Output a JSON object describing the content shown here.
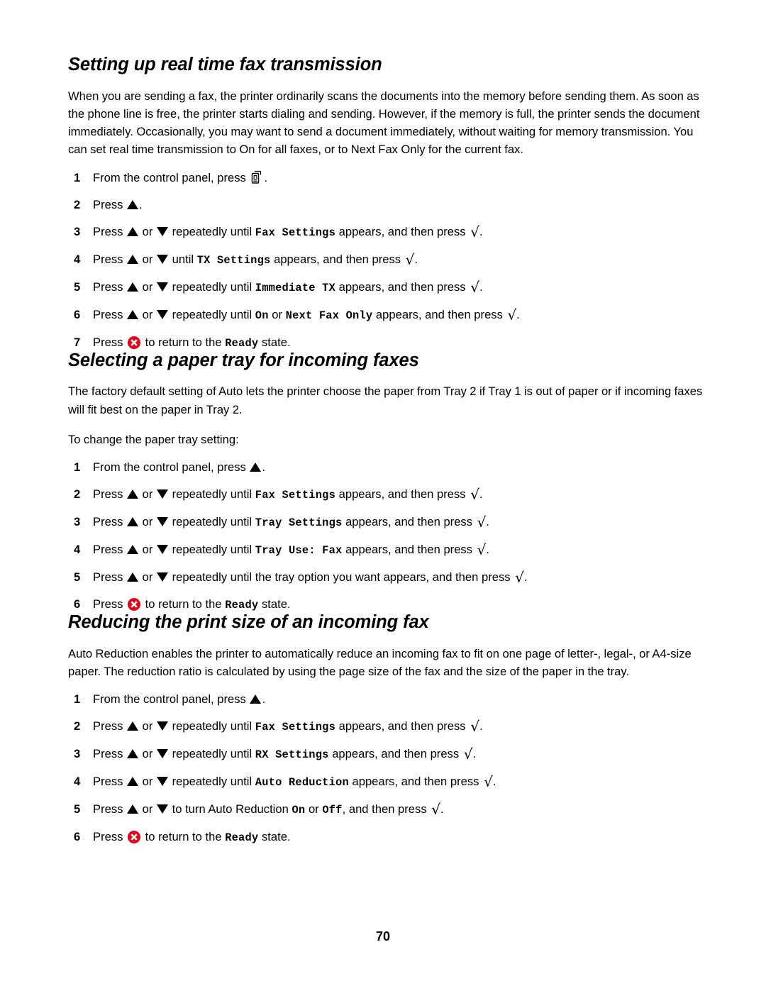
{
  "page": {
    "number": "70",
    "accent_red": "#e10019",
    "text_color": "#000000",
    "background": "#ffffff"
  },
  "sections": [
    {
      "heading": "Setting up real time fax transmission",
      "paragraphs": [
        "When you are sending a fax, the printer ordinarily scans the documents into the memory before sending them. As soon as the phone line is free, the printer starts dialing and sending. However, if the memory is full, the printer sends the document immediately. Occasionally, you may want to send a document immediately, without waiting for memory transmission. You can set real time transmission to On for all faxes, or to Next Fax Only for the current fax."
      ],
      "steps": [
        {
          "num": "1",
          "pre": "From the control panel, press ",
          "icon": "fax-machine-icon",
          "post": "."
        },
        {
          "num": "2",
          "pre": "Press ",
          "icon": "triangle-up-icon",
          "post": "."
        },
        {
          "num": "3",
          "pre": "Press ",
          "icon": "triangle-up-icon",
          "mid1": " or ",
          "icon2": "triangle-down-icon",
          "mid2": " repeatedly until ",
          "mono": "Fax Settings",
          "mid3": " appears, and then press ",
          "icon3": "check-icon",
          "post": "."
        },
        {
          "num": "4",
          "pre": "Press ",
          "icon": "triangle-up-icon",
          "mid1": " or ",
          "icon2": "triangle-down-icon",
          "mid2": " until ",
          "mono": "TX Settings",
          "mid3": " appears, and then press ",
          "icon3": "check-icon",
          "post": "."
        },
        {
          "num": "5",
          "pre": "Press ",
          "icon": "triangle-up-icon",
          "mid1": " or ",
          "icon2": "triangle-down-icon",
          "mid2": " repeatedly until ",
          "mono": "Immediate TX",
          "mid3": " appears, and then press ",
          "icon3": "check-icon",
          "post": "."
        },
        {
          "num": "6",
          "pre": "Press ",
          "icon": "triangle-up-icon",
          "mid1": " or ",
          "icon2": "triangle-down-icon",
          "mid2": " repeatedly until ",
          "mono": "On",
          "mid2b": " or ",
          "mono_b": "Next Fax Only",
          "mid3": " appears, and then press ",
          "icon3": "check-icon",
          "post": "."
        },
        {
          "num": "7",
          "pre": "Press ",
          "icon": "cancel-x-icon",
          "mid2": " to return to the ",
          "mono": "Ready",
          "mid3": " state.",
          "post": ""
        }
      ]
    },
    {
      "heading": "Selecting a paper tray for incoming faxes",
      "paragraphs": [
        "The factory default setting of Auto lets the printer choose the paper from Tray 2 if Tray 1 is out of paper or if incoming faxes will fit best on the paper in Tray 2.",
        "To change the paper tray setting:"
      ],
      "steps": [
        {
          "num": "1",
          "pre": "From the control panel, press ",
          "icon": "triangle-up-icon",
          "post": "."
        },
        {
          "num": "2",
          "pre": "Press ",
          "icon": "triangle-up-icon",
          "mid1": " or ",
          "icon2": "triangle-down-icon",
          "mid2": " repeatedly until ",
          "mono": "Fax Settings",
          "mid3": " appears, and then press ",
          "icon3": "check-icon",
          "post": "."
        },
        {
          "num": "3",
          "pre": "Press ",
          "icon": "triangle-up-icon",
          "mid1": " or ",
          "icon2": "triangle-down-icon",
          "mid2": " repeatedly until ",
          "mono": "Tray Settings",
          "mid3": " appears, and then press ",
          "icon3": "check-icon",
          "post": "."
        },
        {
          "num": "4",
          "pre": "Press ",
          "icon": "triangle-up-icon",
          "mid1": " or ",
          "icon2": "triangle-down-icon",
          "mid2": " repeatedly until ",
          "mono": "Tray Use:  Fax",
          "mid3": " appears, and then press ",
          "icon3": "check-icon",
          "post": "."
        },
        {
          "num": "5",
          "pre": "Press ",
          "icon": "triangle-up-icon",
          "mid1": " or ",
          "icon2": "triangle-down-icon",
          "mid2": " repeatedly until the tray option you want appears, and then press ",
          "icon3": "check-icon",
          "post": "."
        },
        {
          "num": "6",
          "pre": "Press ",
          "icon": "cancel-x-icon",
          "mid2": " to return to the ",
          "mono": "Ready",
          "mid3": " state.",
          "post": ""
        }
      ]
    },
    {
      "heading": "Reducing the print size of an incoming fax",
      "paragraphs": [
        "Auto Reduction enables the printer to automatically reduce an incoming fax to fit on one page of letter-, legal-, or A4-size paper. The reduction ratio is calculated by using the page size of the fax and the size of the paper in the tray."
      ],
      "steps": [
        {
          "num": "1",
          "pre": "From the control panel, press ",
          "icon": "triangle-up-icon",
          "post": "."
        },
        {
          "num": "2",
          "pre": "Press ",
          "icon": "triangle-up-icon",
          "mid1": " or ",
          "icon2": "triangle-down-icon",
          "mid2": " repeatedly until ",
          "mono": "Fax Settings",
          "mid3": " appears, and then press ",
          "icon3": "check-icon",
          "post": "."
        },
        {
          "num": "3",
          "pre": "Press ",
          "icon": "triangle-up-icon",
          "mid1": " or ",
          "icon2": "triangle-down-icon",
          "mid2": " repeatedly until ",
          "mono": "RX Settings",
          "mid3": " appears, and then press ",
          "icon3": "check-icon",
          "post": "."
        },
        {
          "num": "4",
          "pre": "Press ",
          "icon": "triangle-up-icon",
          "mid1": " or ",
          "icon2": "triangle-down-icon",
          "mid2": " repeatedly until ",
          "mono": "Auto Reduction",
          "mid3": " appears, and then press ",
          "icon3": "check-icon",
          "post": "."
        },
        {
          "num": "5",
          "pre": "Press ",
          "icon": "triangle-up-icon",
          "mid1": " or ",
          "icon2": "triangle-down-icon",
          "mid2": " to turn Auto Reduction ",
          "mono": "On",
          "mid2b": " or ",
          "mono_b": "Off",
          "mid3": ", and then press ",
          "icon3": "check-icon",
          "post": "."
        },
        {
          "num": "6",
          "pre": "Press ",
          "icon": "cancel-x-icon",
          "mid2": " to return to the ",
          "mono": "Ready",
          "mid3": " state.",
          "post": ""
        }
      ]
    }
  ]
}
